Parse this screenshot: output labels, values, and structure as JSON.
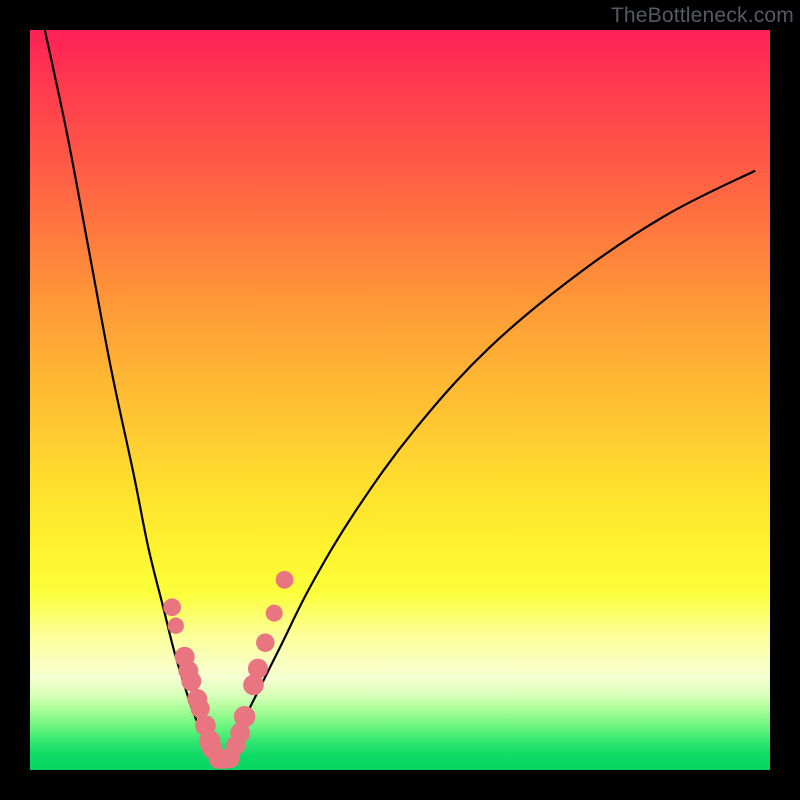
{
  "watermark": "TheBottleneck.com",
  "colors": {
    "dot": "#e97580",
    "curve": "#000000",
    "frame": "#000000"
  },
  "chart_data": {
    "type": "line",
    "title": "",
    "xlabel": "",
    "ylabel": "",
    "xlim": [
      0,
      100
    ],
    "ylim": [
      0,
      100
    ],
    "grid": false,
    "legend": false,
    "note": "V-shaped curve (two branches) plotted over vertical rainbow gradient. Axes are unlabeled; x/y values below are approximate percentages of plot width/height measured from bottom-left.",
    "series": [
      {
        "name": "left-branch",
        "x": [
          2,
          5,
          8,
          11,
          14,
          16,
          18,
          19.5,
          21,
          22,
          23,
          23.8,
          24.5,
          25,
          25.4
        ],
        "y": [
          100,
          86,
          70,
          54,
          40,
          30,
          22,
          16,
          11,
          8,
          5.5,
          3.8,
          2.5,
          1.6,
          1.2
        ]
      },
      {
        "name": "right-branch",
        "x": [
          25.4,
          26,
          27,
          28,
          29.5,
          31.5,
          34,
          38,
          44,
          52,
          62,
          74,
          86,
          98
        ],
        "y": [
          1.2,
          1.8,
          3.2,
          5,
          8,
          12,
          17,
          25,
          35,
          46,
          57,
          67,
          75,
          81
        ]
      }
    ],
    "scatter": {
      "name": "sample-dots",
      "note": "Pink dots clustered near the minimum along both branches",
      "points": [
        {
          "x": 19.2,
          "y": 22.0,
          "r": 1.2
        },
        {
          "x": 19.7,
          "y": 19.5,
          "r": 1.1
        },
        {
          "x": 20.9,
          "y": 15.3,
          "r": 1.35
        },
        {
          "x": 21.4,
          "y": 13.4,
          "r": 1.35
        },
        {
          "x": 21.8,
          "y": 12.0,
          "r": 1.35
        },
        {
          "x": 22.6,
          "y": 9.6,
          "r": 1.35
        },
        {
          "x": 23.0,
          "y": 8.3,
          "r": 1.3
        },
        {
          "x": 23.7,
          "y": 6.0,
          "r": 1.4
        },
        {
          "x": 24.3,
          "y": 3.9,
          "r": 1.45
        },
        {
          "x": 24.6,
          "y": 2.9,
          "r": 1.35
        },
        {
          "x": 25.5,
          "y": 1.5,
          "r": 1.35
        },
        {
          "x": 26.2,
          "y": 1.5,
          "r": 1.35
        },
        {
          "x": 27.0,
          "y": 1.6,
          "r": 1.35
        },
        {
          "x": 27.8,
          "y": 3.3,
          "r": 1.3
        },
        {
          "x": 28.4,
          "y": 5.0,
          "r": 1.35
        },
        {
          "x": 29.0,
          "y": 7.2,
          "r": 1.45
        },
        {
          "x": 30.2,
          "y": 11.5,
          "r": 1.4
        },
        {
          "x": 30.8,
          "y": 13.7,
          "r": 1.35
        },
        {
          "x": 31.8,
          "y": 17.2,
          "r": 1.25
        },
        {
          "x": 33.0,
          "y": 21.2,
          "r": 1.15
        },
        {
          "x": 34.4,
          "y": 25.7,
          "r": 1.2
        }
      ]
    }
  }
}
